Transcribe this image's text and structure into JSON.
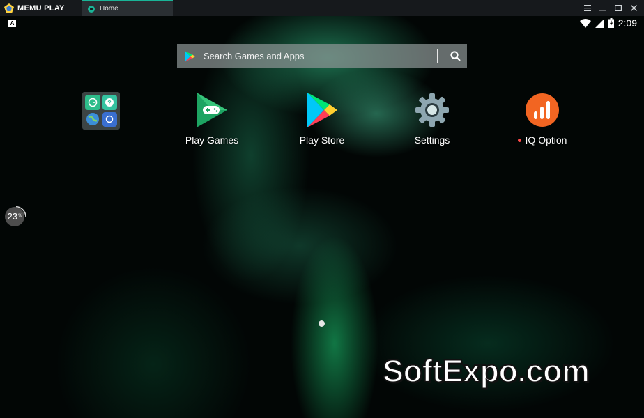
{
  "window": {
    "brand": "MEMU PLAY",
    "tab_label": "Home",
    "controls": [
      "menu-icon",
      "minimize-icon",
      "maximize-icon",
      "close-icon"
    ]
  },
  "status_bar": {
    "time": "2:09",
    "icons": [
      "wifi-icon",
      "signal-icon",
      "battery-charging-icon"
    ]
  },
  "search": {
    "placeholder": "Search Games and Apps"
  },
  "apps": [
    {
      "id": "folder",
      "label": ""
    },
    {
      "id": "play-games",
      "label": "Play Games"
    },
    {
      "id": "play-store",
      "label": "Play Store"
    },
    {
      "id": "settings",
      "label": "Settings"
    },
    {
      "id": "iq-option",
      "label": "IQ Option",
      "new_indicator": true
    }
  ],
  "progress_widget": {
    "value": "23",
    "unit": "%"
  },
  "watermark": "SoftExpo.com",
  "colors": {
    "accent": "#19b497",
    "iq_option": "#f26522",
    "new_dot": "#ff4a4a"
  }
}
